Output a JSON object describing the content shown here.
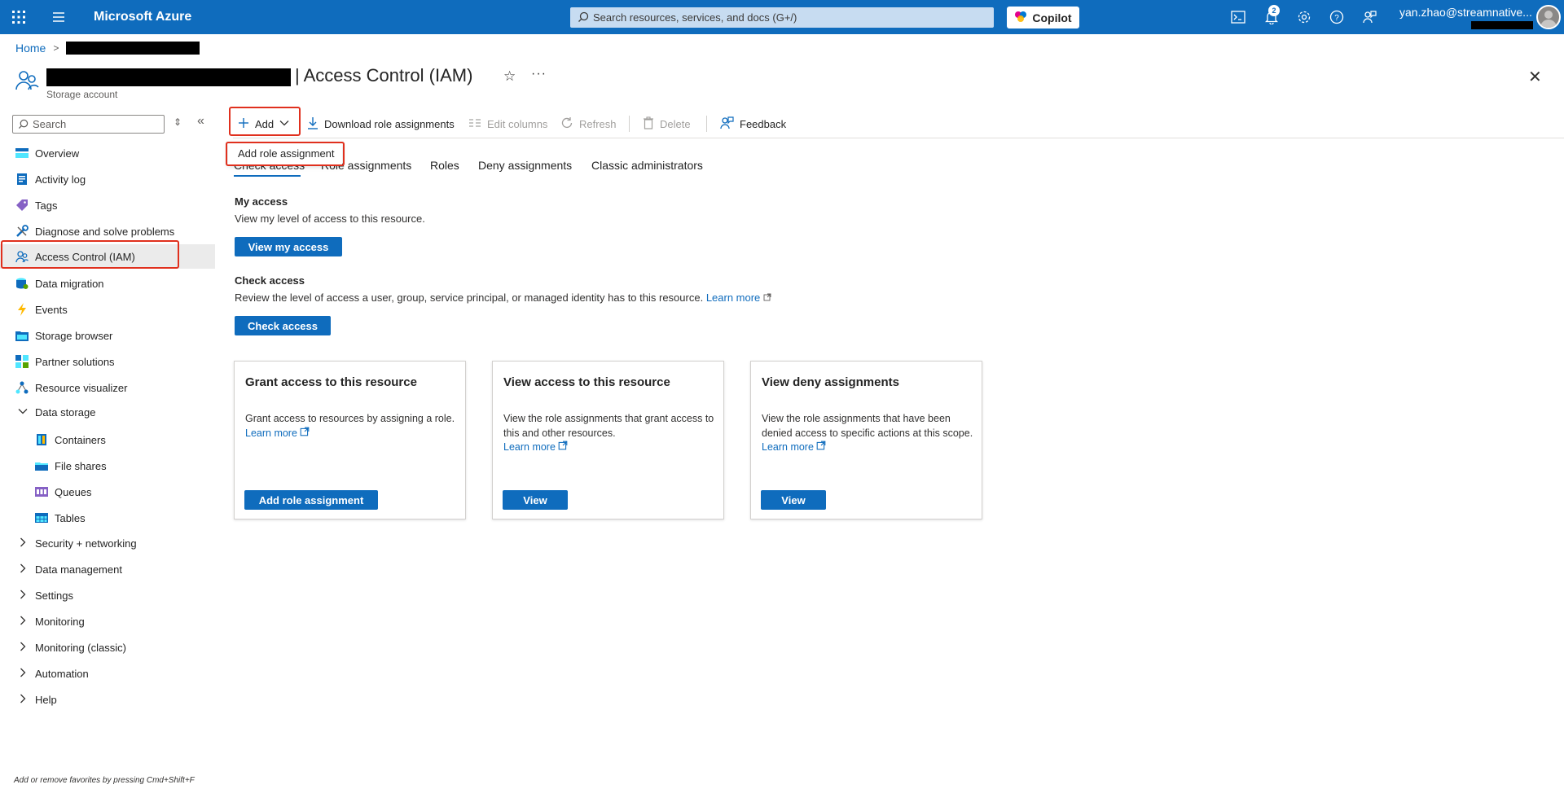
{
  "topbar": {
    "brand": "Microsoft Azure",
    "search_placeholder": "Search resources, services, and docs (G+/)",
    "copilot_label": "Copilot",
    "notification_count": "2",
    "user_email": "yan.zhao@streamnative...",
    "icons": [
      "waffle-icon",
      "hamburger-icon",
      "cloud-shell-icon",
      "bell-icon",
      "gear-icon",
      "help-icon",
      "feedback-icon"
    ]
  },
  "breadcrumb": {
    "home": "Home",
    "separator": ">"
  },
  "header": {
    "title": "| Access Control (IAM)",
    "subtitle": "Storage account",
    "star": "☆",
    "more": "···",
    "close": "✕"
  },
  "sidebar": {
    "search_placeholder": "Search",
    "items": [
      {
        "label": "Overview"
      },
      {
        "label": "Activity log"
      },
      {
        "label": "Tags"
      },
      {
        "label": "Diagnose and solve problems"
      },
      {
        "label": "Access Control (IAM)"
      },
      {
        "label": "Data migration"
      },
      {
        "label": "Events"
      },
      {
        "label": "Storage browser"
      },
      {
        "label": "Partner solutions"
      },
      {
        "label": "Resource visualizer"
      },
      {
        "label": "Data storage"
      },
      {
        "label": "Containers"
      },
      {
        "label": "File shares"
      },
      {
        "label": "Queues"
      },
      {
        "label": "Tables"
      },
      {
        "label": "Security + networking"
      },
      {
        "label": "Data management"
      },
      {
        "label": "Settings"
      },
      {
        "label": "Monitoring"
      },
      {
        "label": "Monitoring (classic)"
      },
      {
        "label": "Automation"
      },
      {
        "label": "Help"
      }
    ],
    "favorites_hint": "Add or remove favorites by pressing Cmd+Shift+F"
  },
  "toolbar": {
    "add": "Add",
    "download": "Download role assignments",
    "edit_columns": "Edit columns",
    "refresh": "Refresh",
    "delete": "Delete",
    "feedback": "Feedback"
  },
  "dropdown": {
    "item": "Add role assignment"
  },
  "tabs": [
    "Check access",
    "Role assignments",
    "Roles",
    "Deny assignments",
    "Classic administrators"
  ],
  "my_access": {
    "heading": "My access",
    "text": "View my level of access to this resource.",
    "button": "View my access"
  },
  "check_access": {
    "heading": "Check access",
    "text": "Review the level of access a user, group, service principal, or managed identity has to this resource.",
    "learn_more": "Learn more",
    "button": "Check access"
  },
  "cards": [
    {
      "title": "Grant access to this resource",
      "desc": "Grant access to resources by assigning a role.",
      "learn_more": "Learn more",
      "button": "Add role assignment"
    },
    {
      "title": "View access to this resource",
      "desc": "View the role assignments that grant access to this and other resources.",
      "learn_more": "Learn more",
      "button": "View"
    },
    {
      "title": "View deny assignments",
      "desc": "View the role assignments that have been denied access to specific actions at this scope.",
      "learn_more": "Learn more",
      "button": "View"
    }
  ],
  "colors": {
    "azure_blue": "#0f6cbd",
    "highlight_red": "#e0301e"
  }
}
